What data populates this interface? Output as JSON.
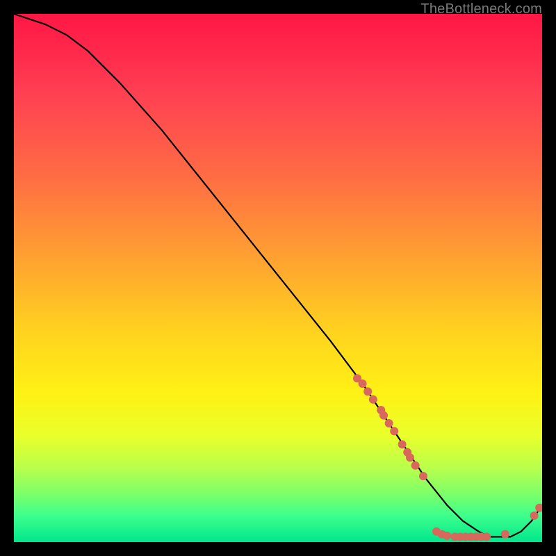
{
  "watermark": "TheBottleneck.com",
  "colors": {
    "dot": "#d8675c",
    "curve": "#000000"
  },
  "chart_data": {
    "type": "line",
    "title": "",
    "xlabel": "",
    "ylabel": "",
    "xlim": [
      0,
      100
    ],
    "ylim": [
      0,
      100
    ],
    "grid": false,
    "legend": false,
    "annotations": [
      "TheBottleneck.com"
    ],
    "series": [
      {
        "name": "bottleneck-curve",
        "x": [
          0,
          3,
          6,
          10,
          14,
          20,
          28,
          36,
          44,
          52,
          60,
          66,
          70,
          74,
          78,
          82,
          85,
          88,
          90,
          92,
          94,
          96,
          98,
          100
        ],
        "y": [
          100,
          99,
          98,
          96,
          93,
          87,
          78,
          68,
          58,
          48,
          38,
          30,
          24,
          18,
          12,
          7,
          4,
          2,
          1,
          1,
          1,
          2,
          4,
          7
        ]
      }
    ],
    "scatter_points": {
      "name": "highlighted-points",
      "points": [
        {
          "x": 65,
          "y": 31
        },
        {
          "x": 66,
          "y": 30
        },
        {
          "x": 67,
          "y": 28.5
        },
        {
          "x": 68,
          "y": 27
        },
        {
          "x": 69.5,
          "y": 25
        },
        {
          "x": 70,
          "y": 24
        },
        {
          "x": 71,
          "y": 22.5
        },
        {
          "x": 72,
          "y": 21
        },
        {
          "x": 73.5,
          "y": 18.5
        },
        {
          "x": 74.5,
          "y": 17
        },
        {
          "x": 75,
          "y": 16
        },
        {
          "x": 76,
          "y": 14.5
        },
        {
          "x": 77.5,
          "y": 12.5
        },
        {
          "x": 80,
          "y": 2
        },
        {
          "x": 81,
          "y": 1.5
        },
        {
          "x": 82,
          "y": 1.2
        },
        {
          "x": 83.5,
          "y": 1
        },
        {
          "x": 84.5,
          "y": 1
        },
        {
          "x": 85.5,
          "y": 1
        },
        {
          "x": 86.5,
          "y": 1
        },
        {
          "x": 87.5,
          "y": 1
        },
        {
          "x": 88.5,
          "y": 1
        },
        {
          "x": 89.5,
          "y": 1
        },
        {
          "x": 93,
          "y": 1.5
        },
        {
          "x": 98.5,
          "y": 5
        },
        {
          "x": 99.5,
          "y": 6.5
        }
      ]
    }
  }
}
